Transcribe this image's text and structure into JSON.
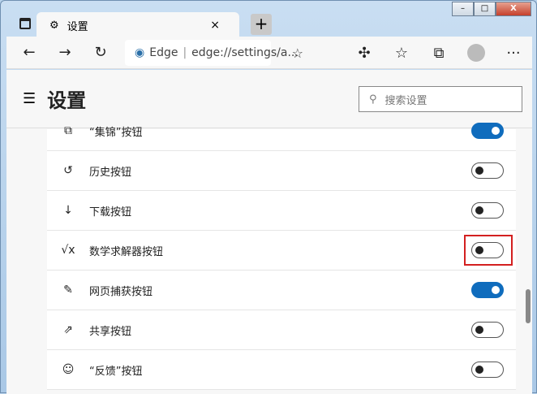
{
  "tab": {
    "title": "设置",
    "close": "×",
    "new_tab": "+"
  },
  "window": {
    "minimize": "–",
    "maximize": "□",
    "close": "X"
  },
  "address": {
    "brand": "Edge",
    "url": "edge://settings/a..."
  },
  "header": {
    "title": "设置",
    "search_placeholder": "搜索设置"
  },
  "rows": [
    {
      "label": "“集锦”按钮",
      "icon": "⧉",
      "on": true
    },
    {
      "label": "历史按钮",
      "icon": "↺",
      "on": false
    },
    {
      "label": "下载按钮",
      "icon": "↓",
      "on": false
    },
    {
      "label": "数学求解器按钮",
      "icon": "√x",
      "on": false
    },
    {
      "label": "网页捕获按钮",
      "icon": "✎",
      "on": true
    },
    {
      "label": "共享按钮",
      "icon": "⇗",
      "on": false
    },
    {
      "label": "“反馈”按钮",
      "icon": "☺",
      "on": false
    }
  ],
  "accent": "#0f6cbd"
}
